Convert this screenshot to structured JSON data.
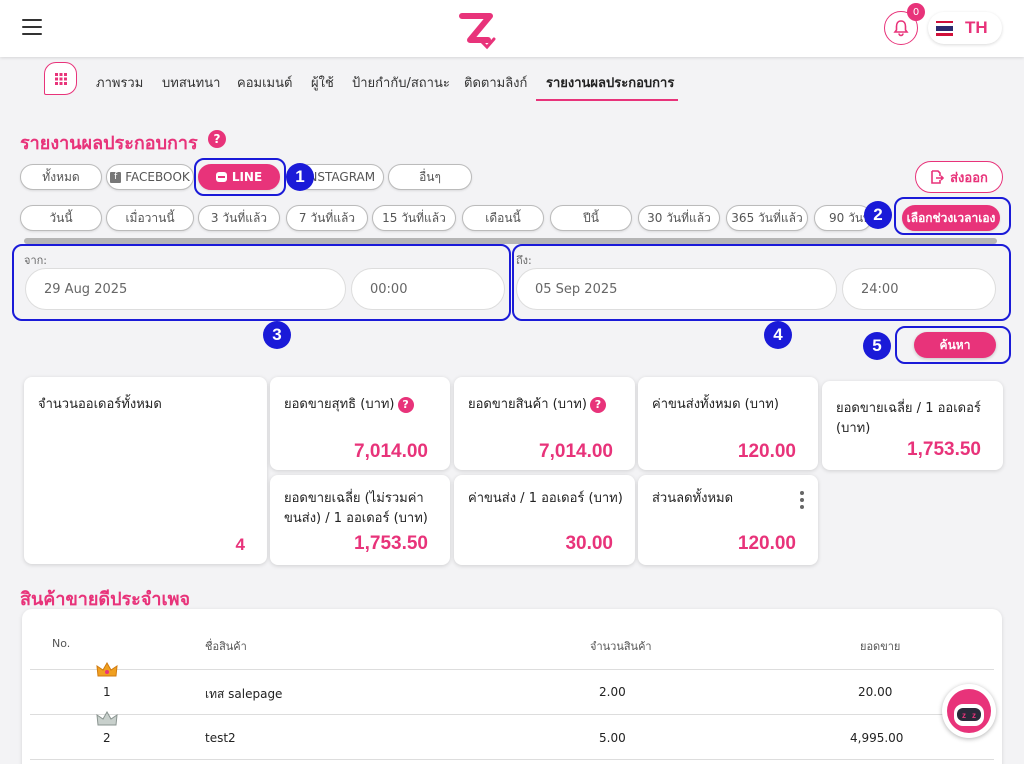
{
  "header": {
    "notification_count": "0",
    "language": "TH"
  },
  "nav": {
    "tabs": [
      {
        "label": "ภาพรวม"
      },
      {
        "label": "บทสนทนา"
      },
      {
        "label": "คอมเมนต์"
      },
      {
        "label": "ผู้ใช้"
      },
      {
        "label": "ป้ายกำกับ/สถานะ"
      },
      {
        "label": "ติดตามลิงก์"
      },
      {
        "label": "รายงานผลประกอบการ"
      }
    ],
    "active": "รายงานผลประกอบการ"
  },
  "page": {
    "title": "รายงานผลประกอบการ"
  },
  "channels": [
    {
      "label": "ทั้งหมด"
    },
    {
      "label": "FACEBOOK"
    },
    {
      "label": "LINE"
    },
    {
      "label": "INSTAGRAM"
    },
    {
      "label": "อื่นๆ"
    }
  ],
  "export_label": "ส่งออก",
  "periods": [
    {
      "label": "วันนี้"
    },
    {
      "label": "เมื่อวานนี้"
    },
    {
      "label": "3 วันที่แล้ว"
    },
    {
      "label": "7 วันที่แล้ว"
    },
    {
      "label": "15 วันที่แล้ว"
    },
    {
      "label": "เดือนนี้"
    },
    {
      "label": "ปีนี้"
    },
    {
      "label": "30 วันที่แล้ว"
    },
    {
      "label": "365 วันที่แล้ว"
    },
    {
      "label": "90 วันที่แล้ว"
    }
  ],
  "custom_range_label": "เลือกช่วงเวลาเอง",
  "date_from": {
    "label": "จาก:",
    "date": "29 Aug 2025",
    "time": "00:00"
  },
  "date_to": {
    "label": "ถึง:",
    "date": "05 Sep 2025",
    "time": "24:00"
  },
  "search_label": "ค้นหา",
  "markers": [
    "1",
    "2",
    "3",
    "4",
    "5"
  ],
  "stats": {
    "total_orders": {
      "label": "จำนวนออเดอร์ทั้งหมด",
      "value": "4"
    },
    "net_sales": {
      "label": "ยอดขายสุทธิ (บาท)",
      "value": "7,014.00"
    },
    "product_sales": {
      "label": "ยอดขายสินค้า (บาท)",
      "value": "7,014.00"
    },
    "total_shipping": {
      "label": "ค่าขนส่งทั้งหมด (บาท)",
      "value": "120.00"
    },
    "avg_sales": {
      "label": "ยอดขายเฉลี่ย / 1 ออเดอร์ (บาท)",
      "value": "1,753.50"
    },
    "avg_sales_ex_ship": {
      "label": "ยอดขายเฉลี่ย (ไม่รวมค่าขนส่ง) / 1 ออเดอร์ (บาท)",
      "value": "1,753.50"
    },
    "avg_shipping": {
      "label": "ค่าขนส่ง / 1 ออเดอร์ (บาท)",
      "value": "30.00"
    },
    "total_discount": {
      "label": "ส่วนลดทั้งหมด",
      "value": "120.00"
    }
  },
  "best_sellers": {
    "title": "สินค้าขายดีประจำเพจ",
    "columns": [
      "No.",
      "ชื่อสินค้า",
      "จำนวนสินค้า",
      "ยอดขาย"
    ],
    "rows": [
      {
        "no": "1",
        "name": "เทส salepage",
        "qty": "2.00",
        "sales": "20.00"
      },
      {
        "no": "2",
        "name": "test2",
        "qty": "5.00",
        "sales": "4,995.00"
      }
    ]
  },
  "colors": {
    "accent": "#e8337a",
    "annotation": "#1a1ad8"
  }
}
